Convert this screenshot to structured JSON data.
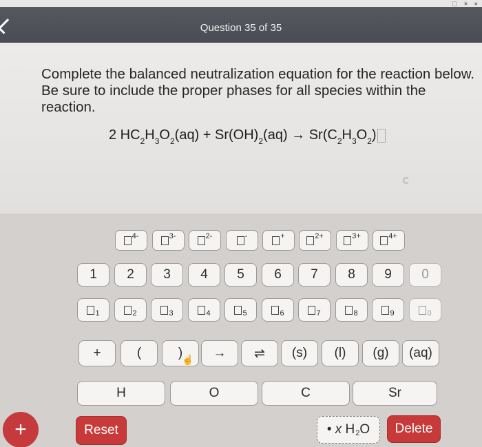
{
  "header": {
    "question_counter": "Question 35 of 35"
  },
  "question": {
    "prompt": "Complete the balanced neutralization equation for the reaction below. Be sure to include the proper phases for all species within the reaction.",
    "equation": {
      "coef1": "2 HC",
      "s1": "2",
      "t1": "H",
      "s2": "3",
      "t2": "O",
      "s3": "2",
      "t3": "(aq) + Sr(OH)",
      "s4": "2",
      "t4": "(aq) → Sr(C",
      "s5": "2",
      "t5": "H",
      "s6": "3",
      "t6": "O",
      "s7": "2",
      "t7": ")"
    }
  },
  "keypad": {
    "charges": [
      "4-",
      "3-",
      "2-",
      "-",
      "+",
      "2+",
      "3+",
      "4+"
    ],
    "digits": [
      "1",
      "2",
      "3",
      "4",
      "5",
      "6",
      "7",
      "8",
      "9",
      "0"
    ],
    "subscripts": [
      "1",
      "2",
      "3",
      "4",
      "5",
      "6",
      "7",
      "8",
      "9",
      "0"
    ],
    "symbols": [
      "+",
      "(",
      ")",
      "→",
      "⇌",
      "(s)",
      "(l)",
      "(g)",
      "(aq)"
    ],
    "elements": [
      "H",
      "O",
      "C",
      "Sr"
    ],
    "water_label": {
      "bullet": "•",
      "x": "x",
      "h": "H",
      "sub": "2",
      "o": "O"
    },
    "reset_label": "Reset",
    "delete_label": "Delete"
  },
  "fab_label": "+",
  "colors": {
    "header_bg": "#4f5158",
    "accent_red": "#c83a3a",
    "keypad_bg": "#d3d0cd"
  }
}
